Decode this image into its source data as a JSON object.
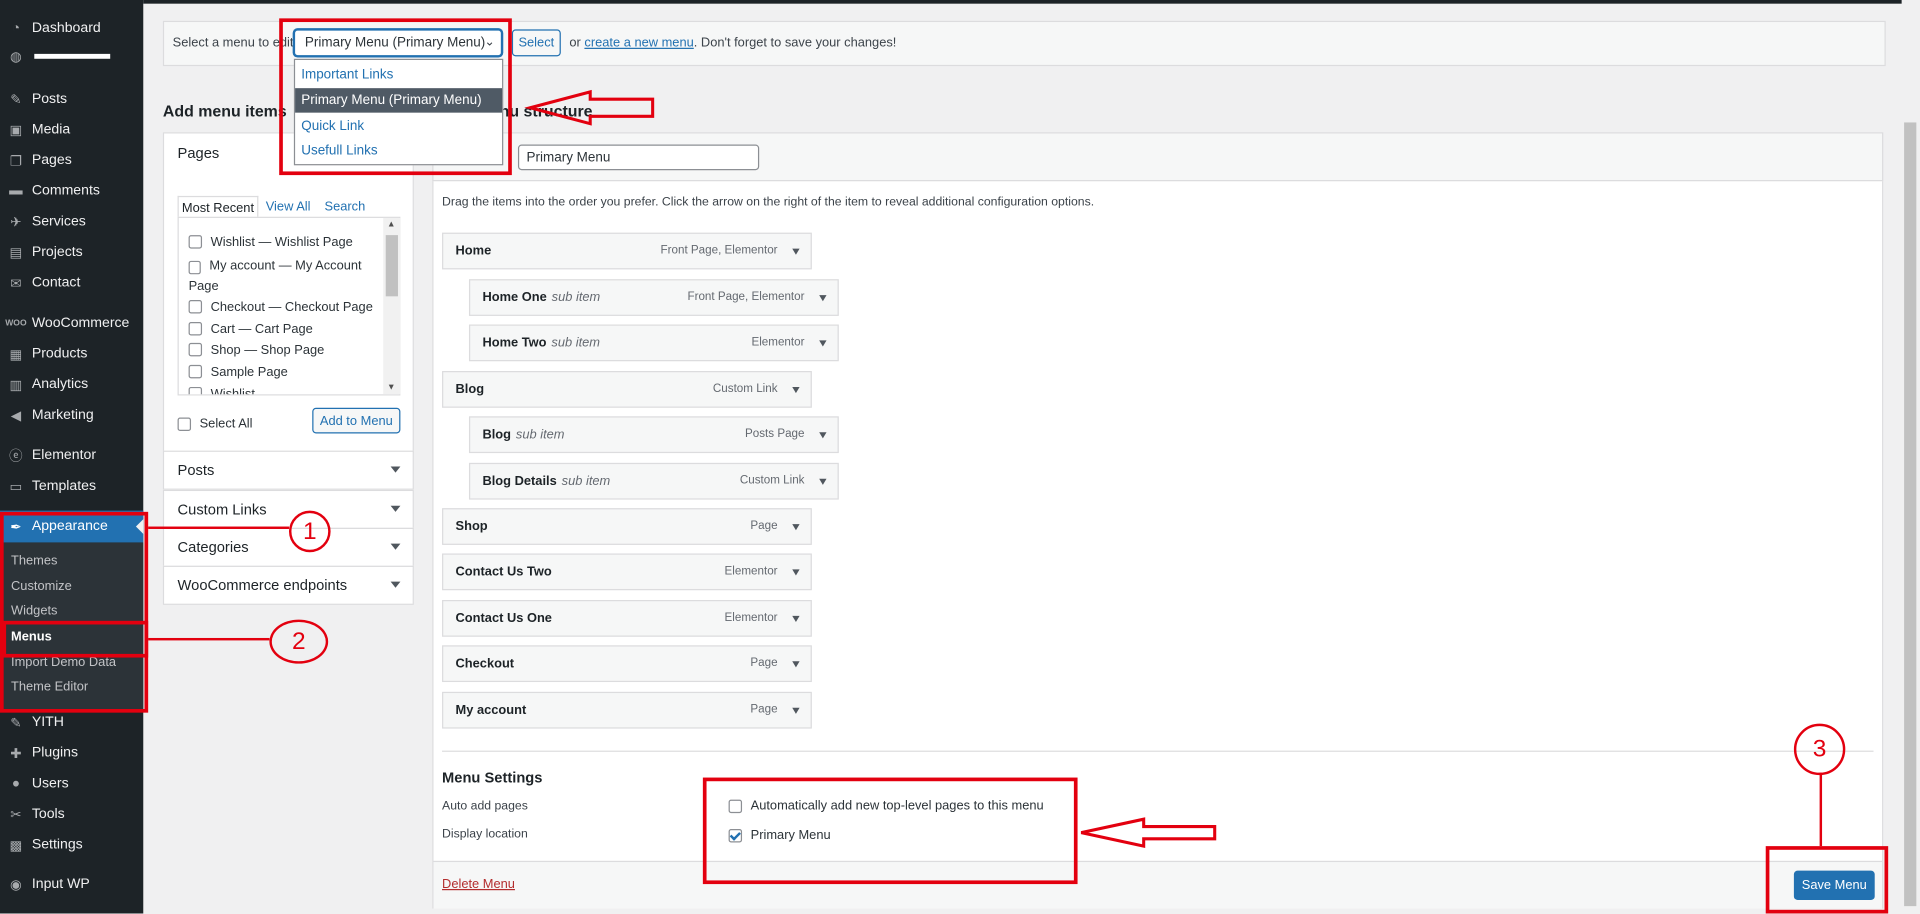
{
  "sidebar": {
    "items": [
      {
        "label": "Dashboard",
        "icon": "dashboard-icon"
      },
      {
        "label": "",
        "icon": "globe-icon"
      },
      {
        "label": "Posts",
        "icon": "pin-icon"
      },
      {
        "label": "Media",
        "icon": "media-icon"
      },
      {
        "label": "Pages",
        "icon": "pages-icon"
      },
      {
        "label": "Comments",
        "icon": "comment-icon"
      },
      {
        "label": "Services",
        "icon": "wrench-icon"
      },
      {
        "label": "Projects",
        "icon": "portfolio-icon"
      },
      {
        "label": "Contact",
        "icon": "mail-icon"
      },
      {
        "label": "WooCommerce",
        "icon": "woo-icon"
      },
      {
        "label": "Products",
        "icon": "archive-icon"
      },
      {
        "label": "Analytics",
        "icon": "bar-chart-icon"
      },
      {
        "label": "Marketing",
        "icon": "megaphone-icon"
      },
      {
        "label": "Elementor",
        "icon": "elementor-icon"
      },
      {
        "label": "Templates",
        "icon": "folder-icon"
      },
      {
        "label": "Appearance",
        "icon": "paintbrush-icon"
      },
      {
        "label": "YITH",
        "icon": "yith-icon"
      },
      {
        "label": "Plugins",
        "icon": "plugin-icon"
      },
      {
        "label": "Users",
        "icon": "users-icon"
      },
      {
        "label": "Tools",
        "icon": "tools-icon"
      },
      {
        "label": "Settings",
        "icon": "settings-icon"
      },
      {
        "label": "Input WP",
        "icon": "input-icon"
      }
    ],
    "submenu": [
      "Themes",
      "Customize",
      "Widgets",
      "Menus",
      "Import Demo Data",
      "Theme Editor"
    ]
  },
  "select_bar": {
    "label": "Select a menu to edit:",
    "selected": "Primary Menu (Primary Menu)",
    "select_button": "Select",
    "or_text": "or",
    "create_link": "create a new menu",
    "reminder": ". Don't forget to save your changes!"
  },
  "dropdown": {
    "options": [
      "Important Links",
      "Primary Menu (Primary Menu)",
      "Quick Link",
      "Usefull Links"
    ]
  },
  "left": {
    "title": "Add menu items",
    "pages_title": "Pages",
    "tabs": [
      "Most Recent",
      "View All",
      "Search"
    ],
    "pages": [
      "Wishlist — Wishlist Page",
      "My account — My Account Page",
      "Checkout — Checkout Page",
      "Cart — Cart Page",
      "Shop — Shop Page",
      "Sample Page",
      "Wishlist"
    ],
    "select_all": "Select All",
    "add_button": "Add to Menu",
    "accordions": [
      "Posts",
      "Custom Links",
      "Categories",
      "WooCommerce endpoints"
    ]
  },
  "right": {
    "title": "Menu structure",
    "menu_name": "Primary Menu",
    "instructions": "Drag the items into the order you prefer. Click the arrow on the right of the item to reveal additional configuration options.",
    "items": [
      {
        "title": "Home",
        "sub": "",
        "type": "Front Page, Elementor"
      },
      {
        "title": "Home One",
        "sub": "sub item",
        "type": "Front Page, Elementor"
      },
      {
        "title": "Home Two",
        "sub": "sub item",
        "type": "Elementor"
      },
      {
        "title": "Blog",
        "sub": "",
        "type": "Custom Link"
      },
      {
        "title": "Blog",
        "sub": "sub item",
        "type": "Posts Page"
      },
      {
        "title": "Blog Details",
        "sub": "sub item",
        "type": "Custom Link"
      },
      {
        "title": "Shop",
        "sub": "",
        "type": "Page"
      },
      {
        "title": "Contact Us Two",
        "sub": "",
        "type": "Elementor"
      },
      {
        "title": "Contact Us One",
        "sub": "",
        "type": "Elementor"
      },
      {
        "title": "Checkout",
        "sub": "",
        "type": "Page"
      },
      {
        "title": "My account",
        "sub": "",
        "type": "Page"
      }
    ],
    "settings": {
      "title": "Menu Settings",
      "auto_add_label": "Auto add pages",
      "auto_add_option": "Automatically add new top-level pages to this menu",
      "display_label": "Display location",
      "display_option": "Primary Menu"
    },
    "delete_link": "Delete Menu",
    "save_button": "Save Menu"
  },
  "annotations": {
    "steps": [
      "1",
      "2",
      "3"
    ],
    "color": "#e3000f"
  },
  "colors": {
    "accent": "#2271b1",
    "sidebar": "#1d2327",
    "danger": "#b32d2e"
  }
}
